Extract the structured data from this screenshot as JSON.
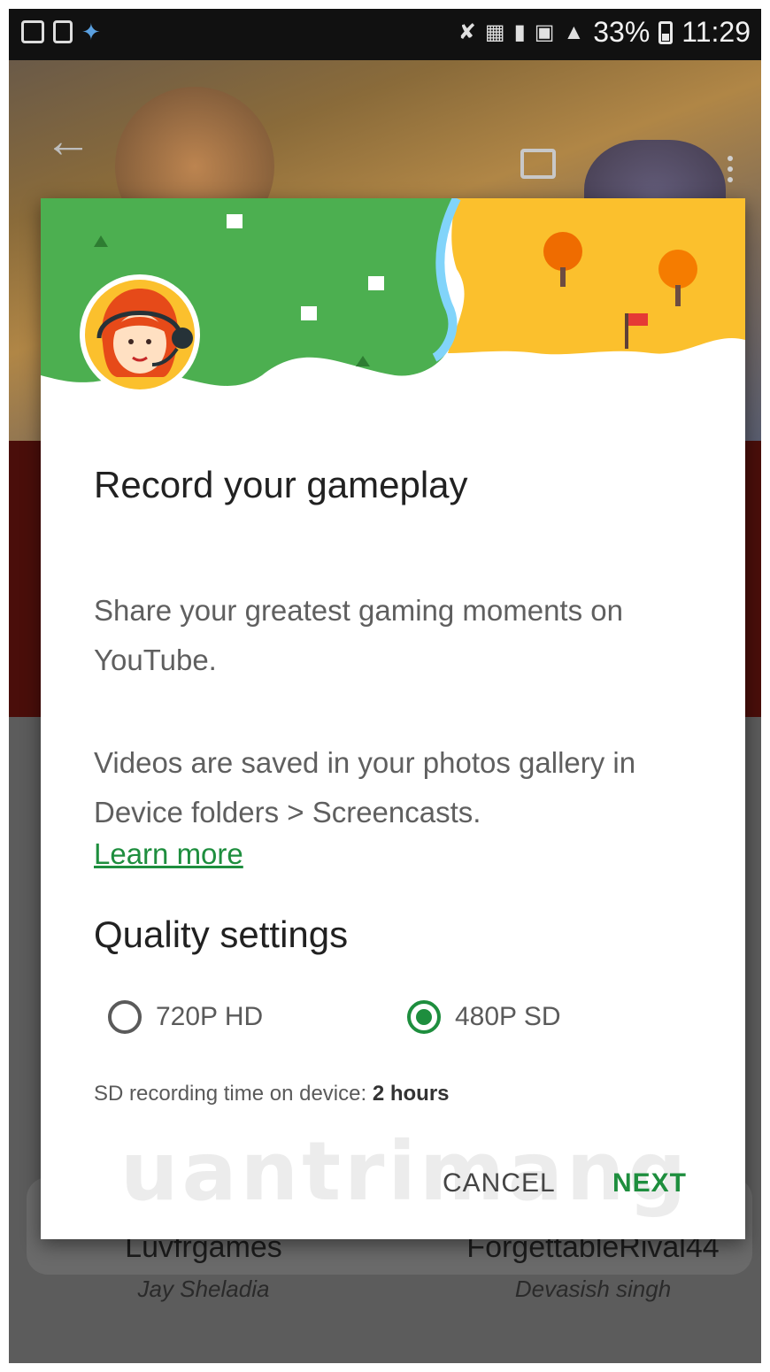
{
  "status_bar": {
    "battery_percent": "33%",
    "time": "11:29",
    "left_icons": [
      "gallery-icon",
      "screenshot-icon",
      "bird-icon"
    ],
    "right_icons": [
      "mute-icon",
      "volte-icon",
      "sim-icon",
      "lte-icon",
      "signal-icon",
      "battery-icon"
    ]
  },
  "dialog": {
    "title": "Record your gameplay",
    "body1": "Share your greatest gaming moments on YouTube.",
    "body2": "Videos are saved in your photos gallery in Device folders > Screencasts.",
    "learn_more": "Learn more",
    "quality_title": "Quality settings",
    "options": [
      {
        "label": "720P HD",
        "selected": false
      },
      {
        "label": "480P SD",
        "selected": true
      }
    ],
    "sd_time_label": "SD recording time on device:",
    "sd_time_value": "2 hours",
    "cancel": "CANCEL",
    "next": "NEXT",
    "accent_color": "#1e8e3e"
  },
  "background": {
    "players": [
      {
        "name": "Luvfrgames",
        "owner": "Jay Sheladia"
      },
      {
        "name": "ForgettableRival44",
        "owner": "Devasish singh"
      }
    ]
  },
  "watermark": "uantrimang"
}
